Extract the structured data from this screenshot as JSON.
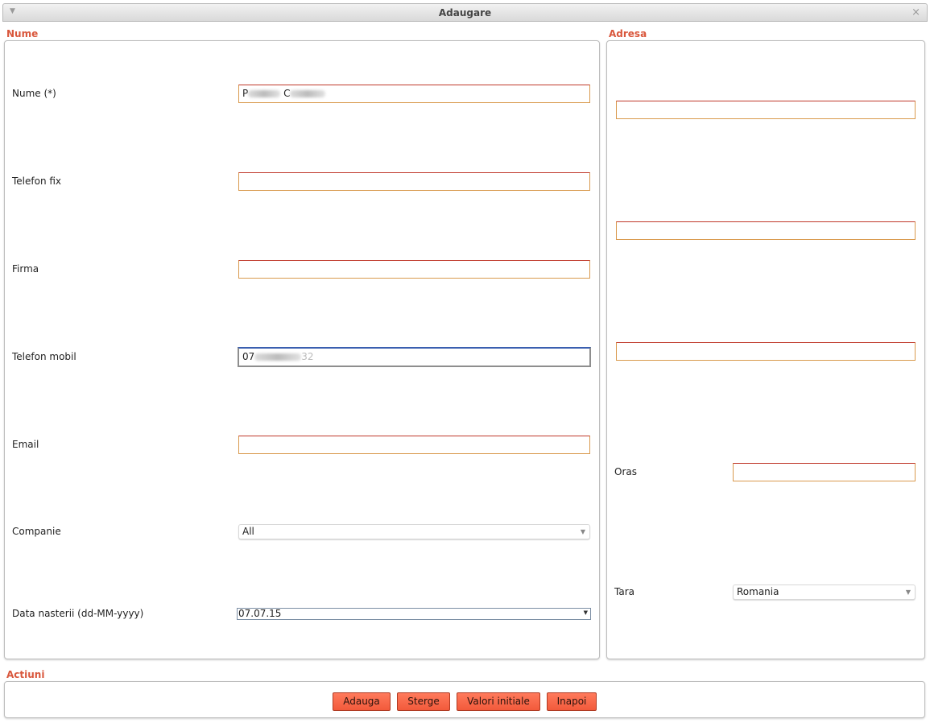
{
  "window": {
    "title": "Adaugare",
    "collapse_icon": "▼",
    "close_icon": "×"
  },
  "nume_section": {
    "title": "Nume",
    "fields": {
      "nume": {
        "label": "Nume (*)",
        "value_prefix": "P",
        "value_mid": "C"
      },
      "telefon_fix": {
        "label": "Telefon fix",
        "value": ""
      },
      "firma": {
        "label": "Firma",
        "value": ""
      },
      "telefon_mobil": {
        "label": "Telefon mobil",
        "value_prefix": "07",
        "value_suffix": "32"
      },
      "email": {
        "label": "Email",
        "value": ""
      },
      "companie": {
        "label": "Companie",
        "value": "All"
      },
      "data_nasterii": {
        "label": "Data nasterii (dd-MM-yyyy)",
        "value": "07.07.15"
      }
    }
  },
  "adresa_section": {
    "title": "Adresa",
    "address_line_1": "",
    "address_line_2": "",
    "address_line_3": "",
    "oras": {
      "label": "Oras",
      "value": ""
    },
    "tara": {
      "label": "Tara",
      "value": "Romania"
    }
  },
  "actiuni_section": {
    "title": "Actiuni",
    "buttons": {
      "adauga": "Adauga",
      "sterge": "Sterge",
      "valori_initiale": "Valori initiale",
      "inapoi": "Inapoi"
    }
  },
  "colors": {
    "section_title": "#d9573c",
    "button_fill": "#f25a3b",
    "input_border": "#d99a4e"
  }
}
